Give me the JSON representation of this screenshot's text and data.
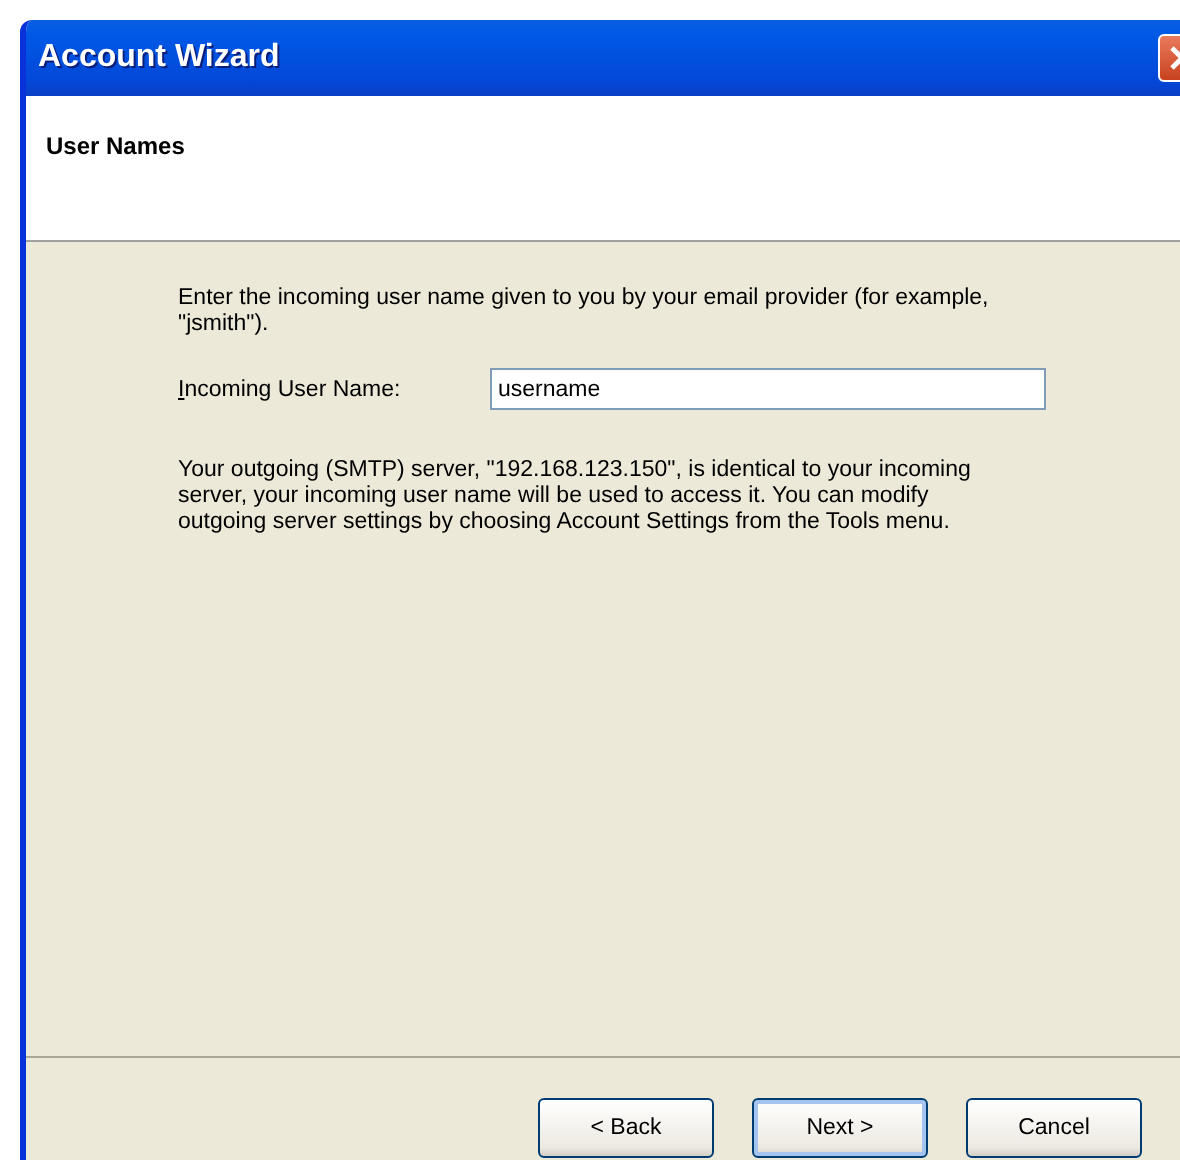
{
  "window": {
    "title": "Account Wizard"
  },
  "header": {
    "title": "User Names"
  },
  "intro": "Enter the incoming user name given to you by your email provider (for example, \"jsmith\").",
  "field": {
    "label": "Incoming User Name:",
    "value": "username"
  },
  "note": "Your outgoing (SMTP) server, \"192.168.123.150\", is identical to your incoming server, your incoming user name will be used to access it. You can modify outgoing server settings by choosing Account Settings from the Tools menu.",
  "buttons": [
    {
      "label": "< Back",
      "default": false
    },
    {
      "label": "Next >",
      "default": true
    },
    {
      "label": "Cancel",
      "default": false
    }
  ]
}
